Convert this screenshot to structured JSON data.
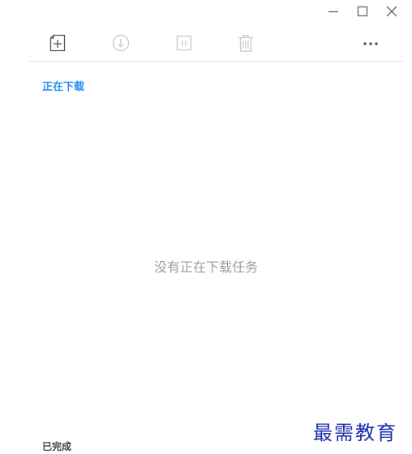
{
  "window": {
    "controls": [
      "minimize",
      "maximize",
      "close"
    ]
  },
  "toolbar": {
    "buttons": [
      {
        "icon": "new-task-icon",
        "enabled": true
      },
      {
        "icon": "start-download-icon",
        "enabled": false
      },
      {
        "icon": "pause-icon",
        "enabled": false
      },
      {
        "icon": "delete-icon",
        "enabled": false
      },
      {
        "icon": "more-icon",
        "enabled": true
      }
    ]
  },
  "downloading": {
    "title": "正在下载",
    "empty_message": "没有正在下载任务"
  },
  "completed": {
    "title": "已完成"
  },
  "watermark": {
    "text": "最需教育"
  },
  "colors": {
    "accent": "#2b8ff2",
    "disabled_icon": "#c8c8c8",
    "icon": "#555555",
    "empty_text": "#9e9e9e",
    "watermark": "#1c2ea8"
  }
}
